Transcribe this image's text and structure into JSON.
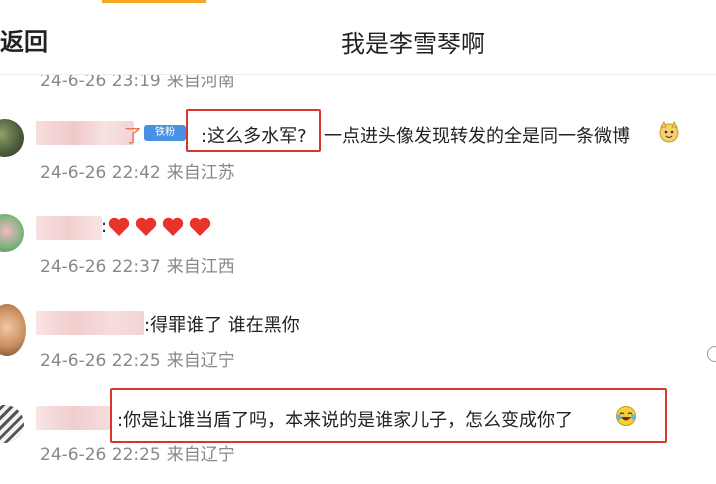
{
  "header": {
    "back_label": "返回",
    "title": "我是李雪琴啊"
  },
  "comments": [
    {
      "meta_date": "24-6-26 23:19",
      "meta_loc": "来自河南",
      "partial": true
    },
    {
      "name_suffix": "了",
      "badge": "铁粉",
      "text_highlighted": ":这么多水军?",
      "text_rest": "一点进头像发现转发的全是同一条微博",
      "emoji": "cat-face-emoji",
      "meta_date": "24-6-26 22:42",
      "meta_loc": "来自江苏"
    },
    {
      "text": ":",
      "hearts": 4,
      "meta_date": "24-6-26 22:37",
      "meta_loc": "来自江西"
    },
    {
      "text": ":得罪谁了 谁在黑你",
      "meta_date": "24-6-26 22:25",
      "meta_loc": "来自辽宁"
    },
    {
      "text": ":你是让谁当盾了吗，本来说的是谁家儿子，怎么变成你了",
      "emoji": "laughing-crying-emoji",
      "meta_date": "24-6-26 22:25",
      "meta_loc": "来自辽宁"
    }
  ],
  "colors": {
    "highlight_box": "#d8352e",
    "meta_text": "#888888",
    "badge_bg": "#4a90e2",
    "heart": "#e8332b",
    "tab_indicator": "#f5a623"
  }
}
